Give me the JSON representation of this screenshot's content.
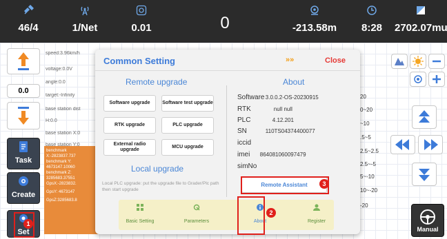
{
  "status_bar": {
    "items": [
      {
        "icon": "satellite-icon",
        "value": "46/4"
      },
      {
        "icon": "signal-tower-icon",
        "value": "1/Net"
      },
      {
        "icon": "target-icon",
        "value": "0.01"
      },
      {
        "icon": "",
        "value": "0"
      },
      {
        "icon": "location-pin-icon",
        "value": "-213.58m"
      },
      {
        "icon": "clock-icon",
        "value": "8:28"
      },
      {
        "icon": "square-icon",
        "value": "2702.07mu"
      }
    ]
  },
  "left_tools": {
    "zoom_value": "0.0",
    "task_label": "Task",
    "create_label": "Create",
    "set_label": "Set"
  },
  "background_text": {
    "lines": [
      "speed:3.96km/h",
      "voltage:0.0V",
      "angle:0.0",
      "target:-Infinity",
      "base station dist",
      "H:0.0",
      "base station X:0",
      "base station Y:0"
    ],
    "benchmark": [
      "benchmark",
      "X:-2823837.737",
      "benchmark Y:",
      "4673147.10060",
      "benchmark Z:",
      "3285683.37551",
      "GpsX:-2823832.",
      "GpsY: 4673147",
      "GpsZ:3285683.8"
    ]
  },
  "right_list": [
    "20",
    "0~20",
    "~10",
    ".5~5",
    "2.5~2.5",
    "2.5~-5",
    "5~-10",
    "10~-20",
    "-20"
  ],
  "manual_label": "Manual",
  "dialog": {
    "title": "Common Setting",
    "arrows": "»»",
    "close_label": "Close",
    "remote_upgrade_title": "Remote upgrade",
    "upgrade_buttons": [
      "Software upgrade",
      "Software test upgrade",
      "RTK upgrade",
      "PLC upgrade",
      "External radio upgrade",
      "MCU upgrade"
    ],
    "local_upgrade_title": "Local upgrade",
    "local_desc": "Local PLC upgrade: put the upgrade file to Grader/Plc path then start upgrade",
    "about_title": "About",
    "about": [
      {
        "key": "Software",
        "value": "3.0.0.2-OS-20230915"
      },
      {
        "key": "RTK",
        "value": "null null"
      },
      {
        "key": "PLC",
        "value": "4.12.201"
      },
      {
        "key": "SN",
        "value": "110TS04374400077"
      },
      {
        "key": "iccid",
        "value": ""
      },
      {
        "key": "imei",
        "value": "864081060097479"
      },
      {
        "key": "simNo",
        "value": ""
      }
    ],
    "remote_assistant_label": "Remote Assistant",
    "tabs": [
      {
        "icon": "grid-icon",
        "label": "Basic Setting"
      },
      {
        "icon": "wrench-icon",
        "label": "Parameters"
      },
      {
        "icon": "info-icon",
        "label": "About"
      },
      {
        "icon": "user-icon",
        "label": "Register"
      }
    ]
  },
  "annotations": [
    "1",
    "2",
    "3"
  ],
  "colors": {
    "accent": "#3d7bd9",
    "close": "#e53935",
    "annotation": "#e0201b",
    "bench": "#e88b3a"
  }
}
